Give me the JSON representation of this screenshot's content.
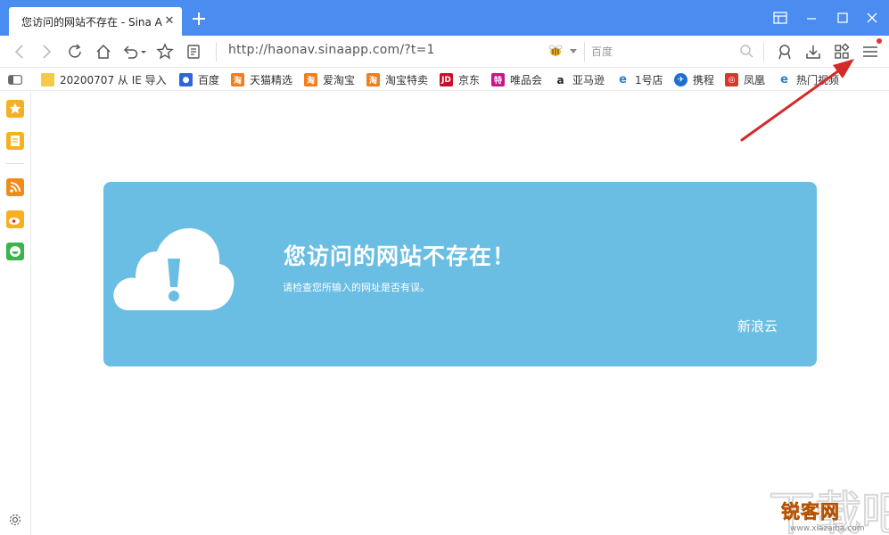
{
  "tab": {
    "title": "您访问的网站不存在 - Sina A"
  },
  "toolbar": {
    "url": "http://haonav.sinaapp.com/?t=1",
    "search_placeholder": "百度"
  },
  "bookmarks": [
    {
      "label": "20200707 从 IE 导入",
      "icon": "folder-icon",
      "color": "#f6c94a"
    },
    {
      "label": "百度",
      "icon": "baidu-icon",
      "color": "#2e66d9"
    },
    {
      "label": "天猫精选",
      "icon": "taobao-icon",
      "color": "#f07e1c"
    },
    {
      "label": "爱淘宝",
      "icon": "taobao-icon",
      "color": "#f07e1c"
    },
    {
      "label": "淘宝特卖",
      "icon": "taobao-icon",
      "color": "#f07e1c"
    },
    {
      "label": "京东",
      "icon": "jd-icon",
      "color": "#c8102e"
    },
    {
      "label": "唯品会",
      "icon": "vip-icon",
      "color": "#c5168a"
    },
    {
      "label": "亚马逊",
      "icon": "amazon-icon",
      "color": "#222222"
    },
    {
      "label": "1号店",
      "icon": "ie-icon",
      "color": "#2b7fd9"
    },
    {
      "label": "携程",
      "icon": "ctrip-icon",
      "color": "#1f6fd0"
    },
    {
      "label": "凤凰",
      "icon": "ifeng-icon",
      "color": "#d23b2a"
    },
    {
      "label": "热门视频",
      "icon": "ie-icon",
      "color": "#2b7fd9"
    }
  ],
  "error": {
    "title": "您访问的网站不存在！",
    "subtitle": "请检查您所输入的网址是否有误。",
    "brand": "新浪云"
  },
  "watermark": {
    "text": "锐客网",
    "url": "www.xiazaiba.com"
  },
  "colors": {
    "titlebar": "#4a8cf0",
    "card": "#6abde3",
    "arrow": "#d42a2a"
  }
}
